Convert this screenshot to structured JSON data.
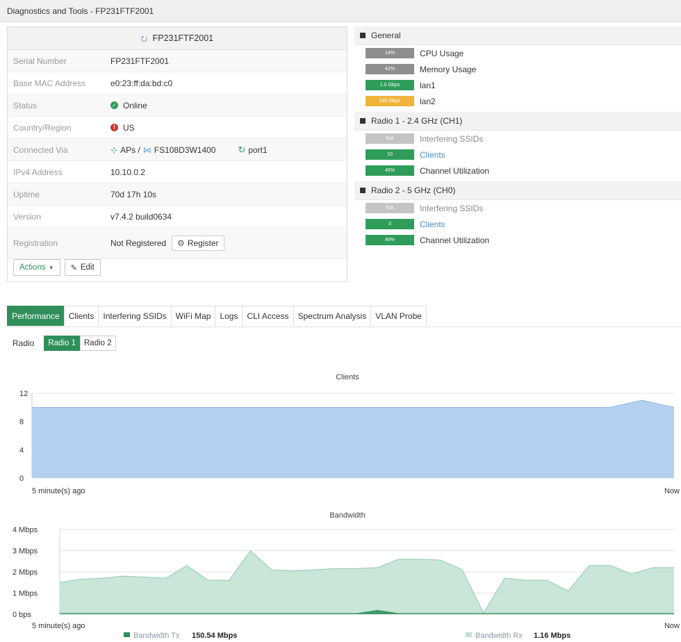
{
  "window": {
    "title": "Diagnostics and Tools - FP231FTF2001"
  },
  "device": {
    "header": "FP231FTF2001",
    "rows": [
      {
        "label": "Serial Number",
        "value": "FP231FTF2001"
      },
      {
        "label": "Base MAC Address",
        "value": "e0:23:ff:da:bd:c0"
      },
      {
        "label": "Status",
        "value": "Online"
      },
      {
        "label": "Country/Region",
        "value": "US"
      },
      {
        "label": "Connected Via",
        "value_aps": "APs /",
        "value_switch": "FS108D3W1400",
        "value_port": "port1"
      },
      {
        "label": "IPv4 Address",
        "value": "10.10.0.2"
      },
      {
        "label": "Uptime",
        "value": "70d 17h 10s"
      },
      {
        "label": "Version",
        "value": "v7.4.2 build0634"
      },
      {
        "label": "Registration",
        "value": "Not Registered",
        "button": "Register"
      }
    ],
    "actions_label": "Actions",
    "edit_label": "Edit"
  },
  "stats": {
    "general": {
      "title": "General",
      "items": [
        {
          "bar": "14%",
          "label": "CPU Usage",
          "color": "#8e8e8e"
        },
        {
          "bar": "42%",
          "label": "Memory Usage",
          "color": "#8e8e8e"
        },
        {
          "bar": "1.0 Gbps",
          "label": "lan1",
          "color": "#2f9c5a"
        },
        {
          "bar": "100 Mbps",
          "label": "lan2",
          "color": "#f1b43a"
        }
      ]
    },
    "radio1": {
      "title": "Radio 1 - 2.4 GHz (CH1)",
      "items": [
        {
          "bar": "N/A",
          "label": "Interfering SSIDs",
          "color": "#c4c4c4"
        },
        {
          "bar": "10",
          "label": "Clients",
          "color": "#2f9c5a"
        },
        {
          "bar": "45%",
          "label": "Channel Utilization",
          "color": "#2f9c5a"
        }
      ]
    },
    "radio2": {
      "title": "Radio 2 - 5 GHz (CH0)",
      "items": [
        {
          "bar": "N/A",
          "label": "Interfering SSIDs",
          "color": "#c4c4c4"
        },
        {
          "bar": "3",
          "label": "Clients",
          "color": "#2f9c5a"
        },
        {
          "bar": "46%",
          "label": "Channel Utilization",
          "color": "#2f9c5a"
        }
      ]
    }
  },
  "tabs": [
    "Performance",
    "Clients",
    "Interfering SSIDs",
    "WiFi Map",
    "Logs",
    "CLI Access",
    "Spectrum Analysis",
    "VLAN Probe"
  ],
  "radio_selector": {
    "label": "Radio",
    "options": [
      "Radio 1",
      "Radio 2"
    ],
    "selected": "Radio 1"
  },
  "chart_data": [
    {
      "type": "area",
      "title": "Clients",
      "x": [
        0,
        1,
        2,
        3,
        4,
        5,
        6,
        7,
        8,
        9,
        10,
        11,
        12,
        13,
        14,
        15,
        16,
        17,
        18,
        19,
        20
      ],
      "x_tick_labels": [
        "5 minute(s) ago",
        "Now"
      ],
      "ylim": [
        0,
        12
      ],
      "y_ticks": [
        "0",
        "4",
        "8",
        "12"
      ],
      "series": [
        {
          "values": [
            10,
            10,
            10,
            10,
            10,
            10,
            10,
            10,
            10,
            10,
            10,
            10,
            10,
            10,
            10,
            10,
            10,
            10,
            10,
            11,
            10
          ],
          "color": "#a9c8ef"
        }
      ],
      "grid": true
    },
    {
      "type": "area",
      "title": "Bandwidth",
      "x": [
        0,
        1,
        2,
        3,
        4,
        5,
        6,
        7,
        8,
        9,
        10,
        11,
        12,
        13,
        14,
        15,
        16,
        17,
        18,
        19,
        20,
        21,
        22,
        23,
        24,
        25,
        26,
        27,
        28,
        29
      ],
      "x_tick_labels": [
        "5 minute(s) ago",
        "Now"
      ],
      "ylim": [
        0,
        4
      ],
      "y_ticks": [
        "0 bps",
        "1 Mbps",
        "2 Mbps",
        "3 Mbps",
        "4 Mbps"
      ],
      "series": [
        {
          "name": "Bandwidth Tx",
          "values": [
            1.5,
            1.65,
            1.7,
            1.8,
            1.75,
            1.7,
            2.3,
            1.6,
            1.6,
            3.0,
            2.1,
            2.05,
            2.1,
            2.15,
            2.15,
            2.2,
            2.6,
            2.6,
            2.55,
            2.1,
            0.05,
            1.7,
            1.6,
            1.6,
            1.1,
            2.3,
            2.3,
            1.9,
            2.2,
            2.2
          ],
          "color": "#bfe2d2"
        },
        {
          "name": "Bandwidth Rx",
          "values": [
            0.05,
            0.05,
            0.05,
            0.05,
            0.05,
            0.05,
            0.05,
            0.05,
            0.05,
            0.05,
            0.05,
            0.05,
            0.05,
            0.05,
            0.05,
            0.2,
            0.05,
            0.05,
            0.05,
            0.05,
            0.05,
            0.05,
            0.05,
            0.05,
            0.05,
            0.05,
            0.05,
            0.05,
            0.05,
            0.05
          ],
          "color": "#2f8f5a"
        }
      ],
      "legend": [
        {
          "label": "Bandwidth Tx",
          "value": "150.54 Mbps"
        },
        {
          "label": "Bandwidth Rx",
          "value": "1.16 Mbps"
        }
      ]
    }
  ]
}
